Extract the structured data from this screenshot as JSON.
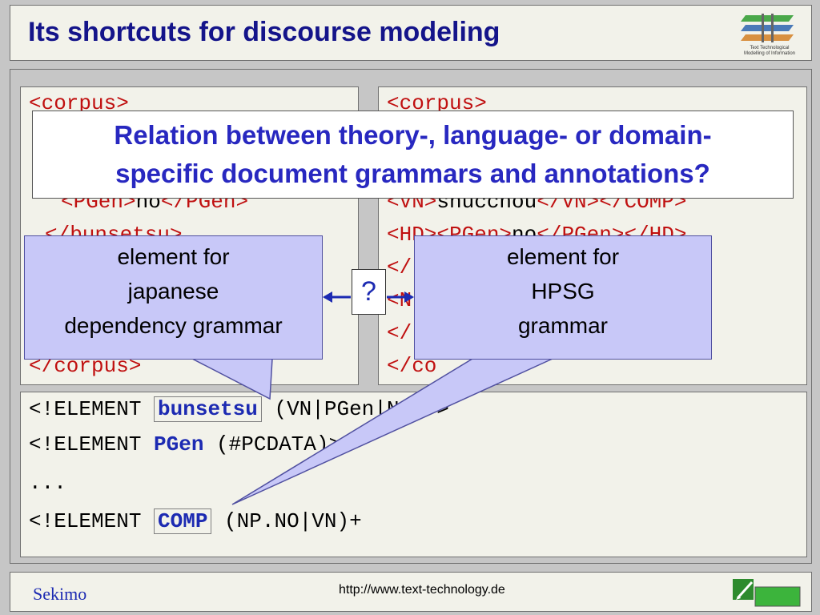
{
  "slide": {
    "title": "Its shortcuts for discourse modeling",
    "logo_text_line1": "Text Technological",
    "logo_text_line2": "Modelling of Information"
  },
  "left_code": {
    "line1": "<corpus>",
    "line4_tag_open": "<PGen>",
    "line4_text": "no",
    "line4_tag_close": "</PGen>",
    "line5": "</bunsetsu>",
    "line9": "</corpus>"
  },
  "right_code": {
    "line1": "<corpus>",
    "line4_tag_open": "<VN>",
    "line4_text": "shucchou",
    "line4_tag_close": "</VN></COMP>",
    "line5_tag_open": "<HD><PGen>",
    "line5_text": "no",
    "line5_tag_close": "</PGen></HD>",
    "line6": "</",
    "line7": "<N",
    "line8": "</",
    "line9": "</co"
  },
  "question": {
    "line1": "Relation between theory-, language- or domain-",
    "line2": "specific document grammars and annotations?"
  },
  "callout_left": {
    "line1": "element for",
    "line2": "japanese",
    "line3": "dependency grammar"
  },
  "callout_right": {
    "line1": "element for",
    "line2": "HPSG",
    "line3": "grammar"
  },
  "qmark": "?",
  "dtd": {
    "line1_prefix": "<!ELEMENT ",
    "line1_keyword": "bunsetsu",
    "line1_suffix": " (VN|PGen|NF)+>",
    "line2_prefix": "<!ELEMENT ",
    "line2_keyword": "PGen",
    "line2_suffix": " (#PCDATA)>",
    "line3": "...",
    "line4_prefix": "<!ELEMENT ",
    "line4_keyword": "COMP",
    "line4_suffix": " (NP.NO|VN)+"
  },
  "footer": {
    "left": "Sekimo",
    "url": "http://www.text-technology.de"
  },
  "colors": {
    "title": "#14148a",
    "tag": "#c01010",
    "keyword": "#1c2ab2",
    "callout_fill": "#c8c8f8",
    "question_text": "#2828c0"
  }
}
